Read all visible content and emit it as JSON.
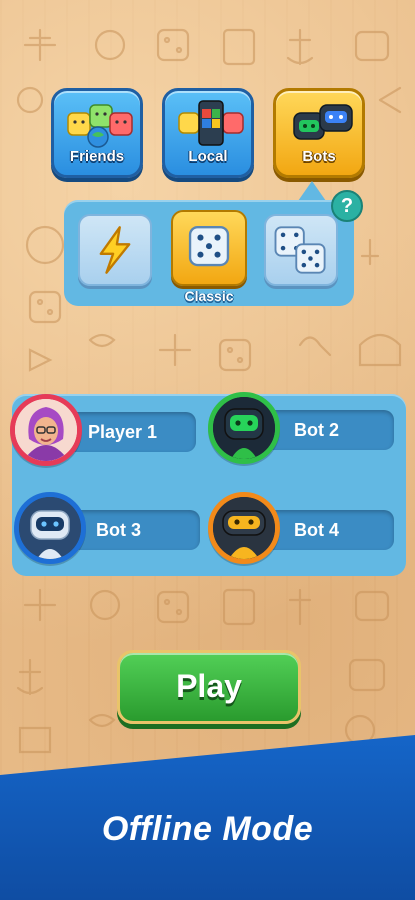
{
  "modes": [
    {
      "label": "Friends",
      "selected": false
    },
    {
      "label": "Local",
      "selected": false
    },
    {
      "label": "Bots",
      "selected": true
    }
  ],
  "submodes": {
    "options": [
      {
        "icon": "lightning-icon",
        "selected": false
      },
      {
        "icon": "single-die-icon",
        "selected": true,
        "label": "Classic"
      },
      {
        "icon": "two-dice-icon",
        "selected": false
      }
    ],
    "help_label": "?"
  },
  "players": [
    {
      "name": "Player 1",
      "avatar": "player-avatar",
      "ring_color": "#e63b58"
    },
    {
      "name": "Bot 2",
      "avatar": "green-bot-avatar",
      "ring_color": "#2fbf48"
    },
    {
      "name": "Bot 3",
      "avatar": "blue-bot-avatar",
      "ring_color": "#1e6fd6"
    },
    {
      "name": "Bot 4",
      "avatar": "yellow-bot-avatar",
      "ring_color": "#f28a1a"
    }
  ],
  "play_label": "Play",
  "footer": {
    "title": "Offline Mode"
  }
}
